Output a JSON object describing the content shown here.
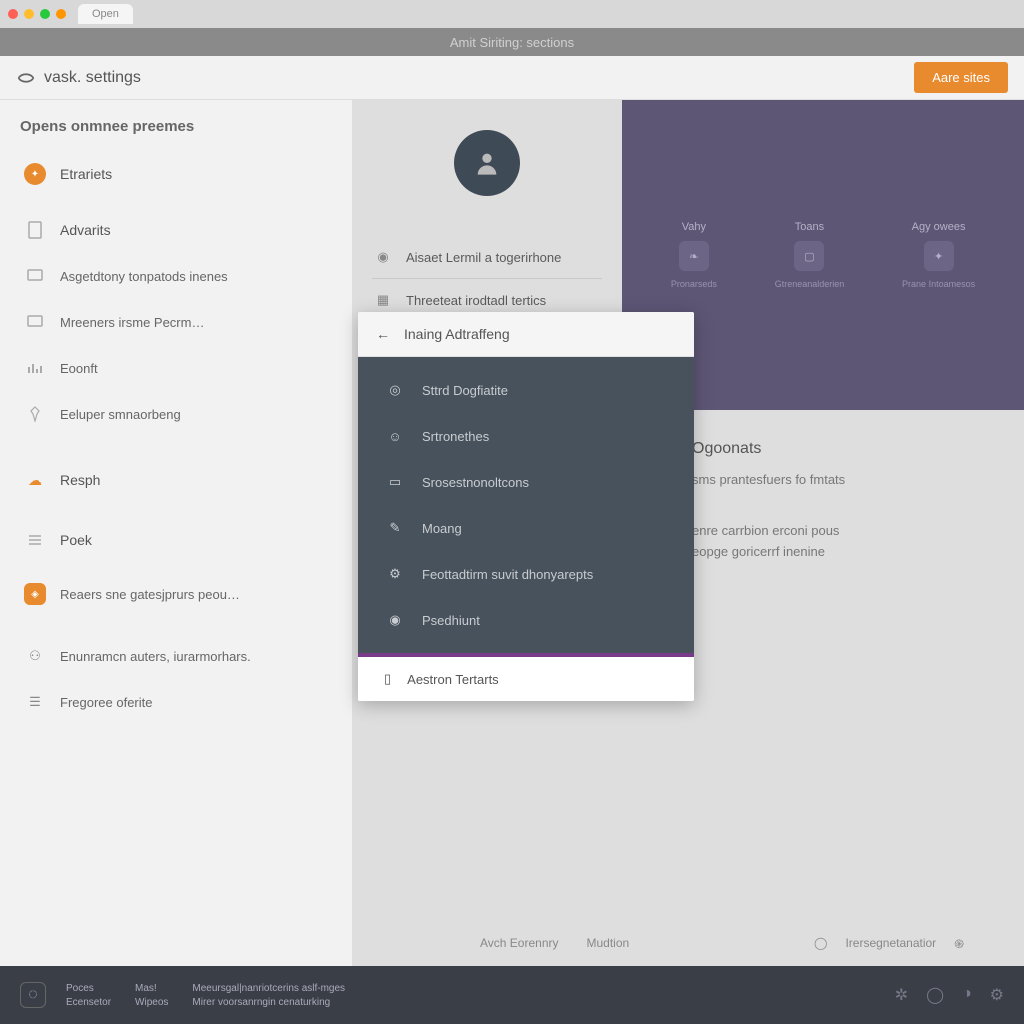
{
  "chrome": {
    "tab_label": "Open"
  },
  "titlebar": "Amit Siriting: sections",
  "header": {
    "logo_text": "vask. settings",
    "cta": "Aare sites"
  },
  "sidebar": {
    "heading": "Opens onmnee preemes",
    "items": [
      {
        "label": "Etrariets"
      },
      {
        "label": "Advarits"
      },
      {
        "label": "Asgetdtony tonpatods inenes"
      },
      {
        "label": "Mreeners irsme Pecrm…"
      },
      {
        "label": "Eoonft"
      },
      {
        "label": "Eeluper smnaorbeng"
      },
      {
        "label": "Resph"
      },
      {
        "label": "Poek"
      },
      {
        "label": "Reaers sne gatesjprurs peou…"
      },
      {
        "label": "Enunramcn auters, iurarmorhars."
      },
      {
        "label": "Fregoree oferite"
      }
    ]
  },
  "hero": {
    "tabs": [
      {
        "label": "Aisaet Lermil a togerirhone"
      },
      {
        "label": "Threeteat irodtadl tertics"
      }
    ],
    "panels": [
      {
        "label": "Vahy",
        "sub": "Pronarseds"
      },
      {
        "label": "Toans",
        "sub": "Gtreneanalderien"
      },
      {
        "label": "Agy owees",
        "sub": "Prane Intoamesos"
      }
    ]
  },
  "dropdown": {
    "header": "Inaing Adtraffeng",
    "items": [
      {
        "label": "Sttrd Dogfiatite"
      },
      {
        "label": "Srtronethes"
      },
      {
        "label": "Srosestnonoltcons"
      },
      {
        "label": "Moang"
      },
      {
        "label": "Feottadtirm suvit dhonyarepts"
      },
      {
        "label": "Psedhiunt"
      }
    ],
    "footer": "Aestron Tertarts"
  },
  "lower": {
    "section_title": "Ogoonats",
    "line1": "sms prantesfuers fo fmtats",
    "line2": "enre carrbion erconi pous",
    "line3": "eopge goricerrf inenine"
  },
  "util_footer": {
    "link1": "Avch Eorennry",
    "link2": "Mudtion",
    "link3": "Irersegnetanatior"
  },
  "bottombar": {
    "col1a": "Poces",
    "col1b": "Ecensetor",
    "col2a": "Mas!",
    "col2b": "Wipeos",
    "line1": "Meeursgal|nanriotcerins aslf-mges",
    "line2": "Mirer voorsanrngin cenaturking"
  }
}
